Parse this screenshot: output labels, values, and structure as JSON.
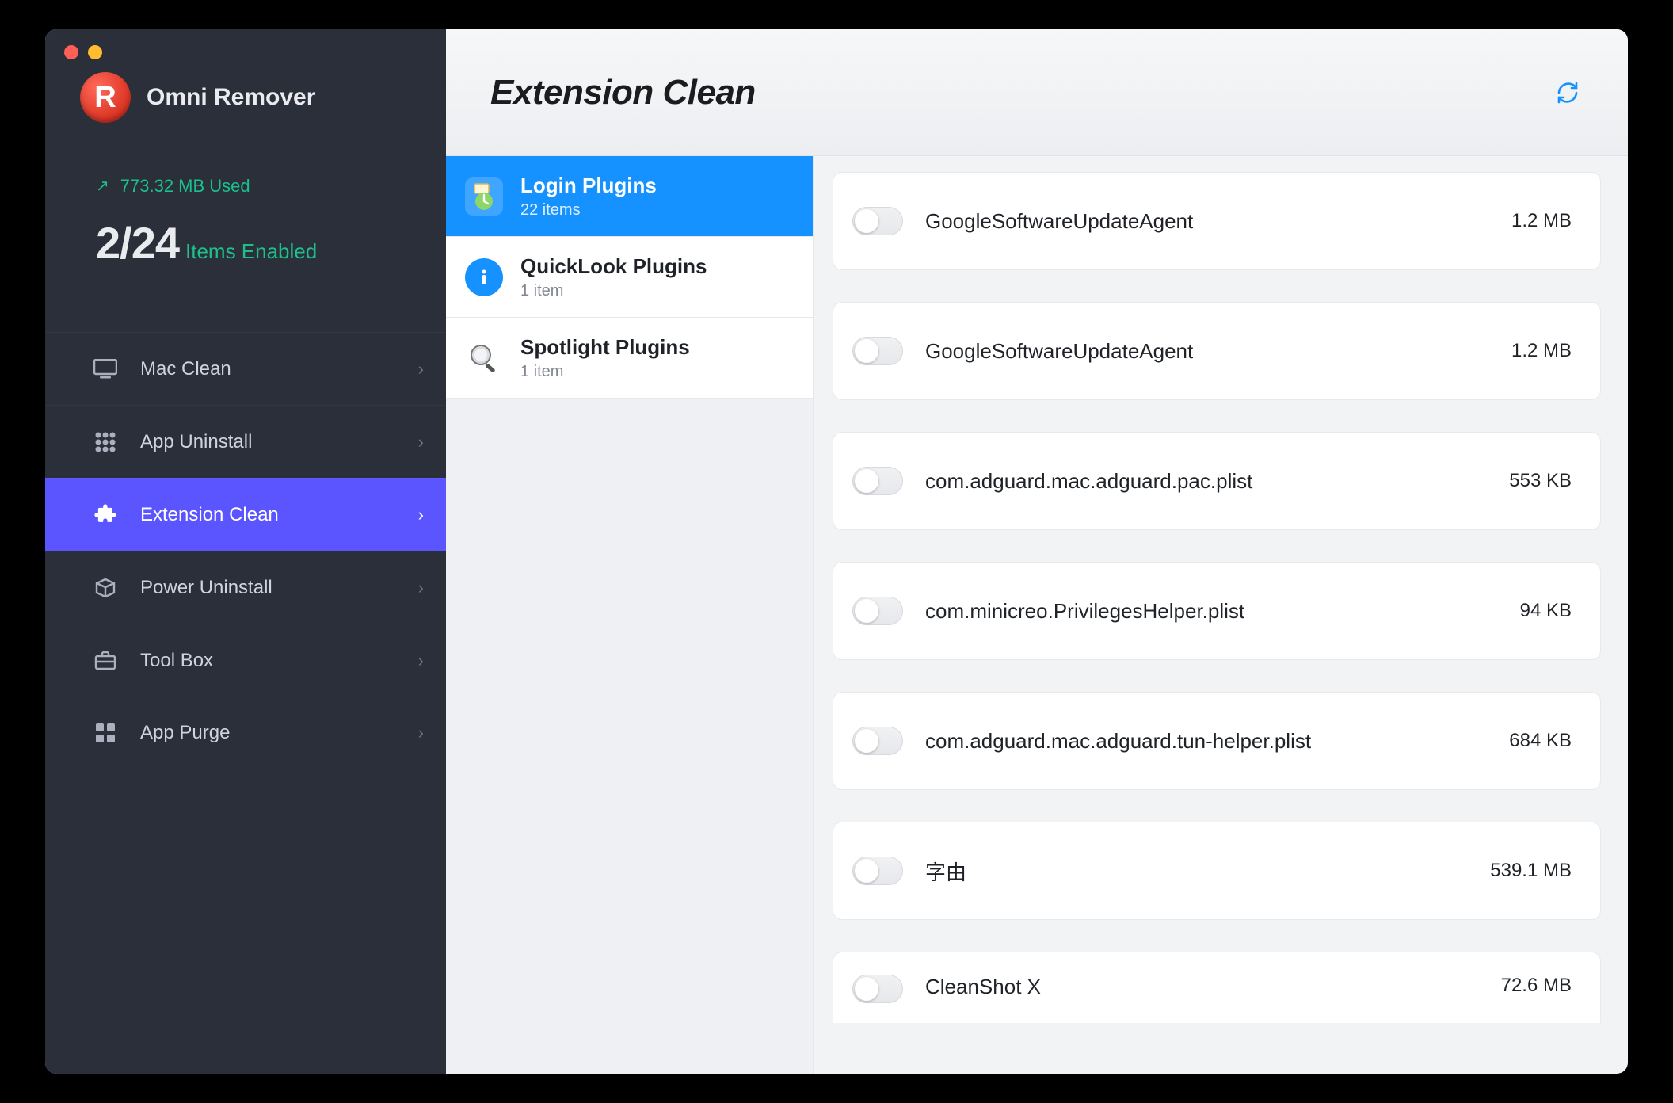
{
  "app": {
    "name": "Omni Remover",
    "logo_letter": "R"
  },
  "status": {
    "used_label": "773.32 MB Used",
    "enabled_count": "2/24",
    "enabled_label": "Items Enabled"
  },
  "page": {
    "title": "Extension Clean"
  },
  "sidebar": {
    "items": [
      {
        "label": "Mac Clean",
        "icon": "monitor-icon",
        "active": false
      },
      {
        "label": "App Uninstall",
        "icon": "grid-icon",
        "active": false
      },
      {
        "label": "Extension Clean",
        "icon": "puzzle-icon",
        "active": true
      },
      {
        "label": "Power Uninstall",
        "icon": "box-icon",
        "active": false
      },
      {
        "label": "Tool Box",
        "icon": "briefcase-icon",
        "active": false
      },
      {
        "label": "App Purge",
        "icon": "tiles-icon",
        "active": false
      }
    ]
  },
  "categories": [
    {
      "title": "Login Plugins",
      "subtitle": "22 items",
      "selected": true
    },
    {
      "title": "QuickLook Plugins",
      "subtitle": "1 item",
      "selected": false
    },
    {
      "title": "Spotlight Plugins",
      "subtitle": "1 item",
      "selected": false
    }
  ],
  "items": [
    {
      "name": "GoogleSoftwareUpdateAgent",
      "size": "1.2 MB"
    },
    {
      "name": "GoogleSoftwareUpdateAgent",
      "size": "1.2 MB"
    },
    {
      "name": "com.adguard.mac.adguard.pac.plist",
      "size": "553 KB"
    },
    {
      "name": "com.minicreo.PrivilegesHelper.plist",
      "size": "94 KB"
    },
    {
      "name": "com.adguard.mac.adguard.tun-helper.plist",
      "size": "684 KB"
    },
    {
      "name": "字由",
      "size": "539.1 MB"
    },
    {
      "name": "CleanShot X",
      "size": "72.6 MB"
    }
  ]
}
